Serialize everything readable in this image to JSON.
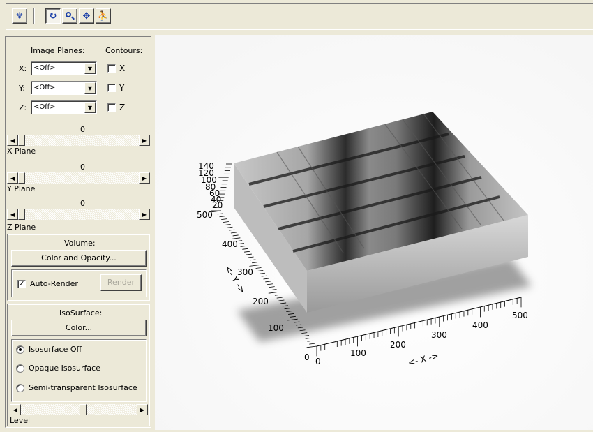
{
  "toolbar": {
    "buttons": [
      {
        "name": "reset-view",
        "icon": "hand-tool-icon",
        "glyph": "♆"
      },
      {
        "name": "rotate",
        "icon": "rotate-icon",
        "glyph": "↻"
      },
      {
        "name": "zoom",
        "icon": "magnifier-icon",
        "glyph": "🔍"
      },
      {
        "name": "pan",
        "icon": "pan-arrows-icon",
        "glyph": "✥"
      },
      {
        "name": "select",
        "icon": "select-icon",
        "glyph": "⛹"
      }
    ]
  },
  "panel": {
    "image_planes_label": "Image Planes:",
    "contours_label": "Contours:",
    "planes": [
      {
        "axis": "X:",
        "value": "<Off>",
        "contour": "X"
      },
      {
        "axis": "Y:",
        "value": "<Off>",
        "contour": "Y"
      },
      {
        "axis": "Z:",
        "value": "<Off>",
        "contour": "Z"
      }
    ],
    "sliders": [
      {
        "value": "0",
        "label": "X Plane"
      },
      {
        "value": "0",
        "label": "Y Plane"
      },
      {
        "value": "0",
        "label": "Z Plane"
      }
    ],
    "volume": {
      "title": "Volume:",
      "color_opacity_button": "Color and Opacity...",
      "auto_render_label": "Auto-Render",
      "auto_render_checked": true,
      "render_button": "Render"
    },
    "isosurface": {
      "title": "IsoSurface:",
      "color_button": "Color...",
      "options": [
        "Isosurface Off",
        "Opaque Isosurface",
        "Semi-transparent Isosurface"
      ],
      "selected": 0,
      "level_label": "Level"
    }
  },
  "plot": {
    "x_axis_label": "<- X ->",
    "y_axis_label": "<- Y ->",
    "x_ticks": [
      "0",
      "100",
      "200",
      "300",
      "400",
      "500"
    ],
    "y_ticks": [
      "0",
      "100",
      "200",
      "300",
      "400",
      "500"
    ],
    "z_ticks": [
      "20",
      "40",
      "60",
      "80",
      "100",
      "120",
      "140"
    ]
  }
}
